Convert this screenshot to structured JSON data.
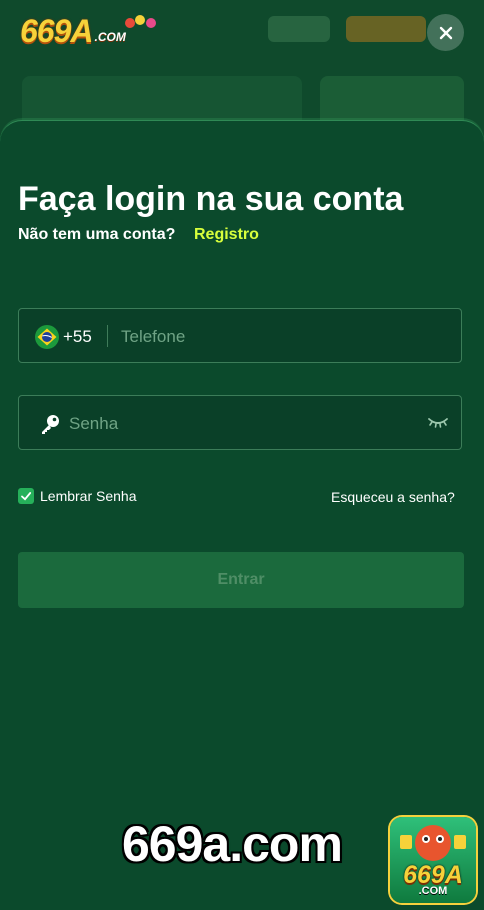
{
  "brand": {
    "logo_text": "669A",
    "logo_suffix": ".COM",
    "watermark": "669a.com",
    "badge_text": "669A",
    "badge_suffix": ".COM"
  },
  "login": {
    "title": "Faça login na sua conta",
    "no_account": "Não tem uma conta?",
    "register": "Registro",
    "phone": {
      "dial_code": "+55",
      "placeholder": "Telefone",
      "value": ""
    },
    "password": {
      "placeholder": "Senha",
      "value": ""
    },
    "remember_label": "Lembrar Senha",
    "remember_checked": true,
    "forgot": "Esqueceu a senha?",
    "submit": "Entrar"
  },
  "icons": {
    "close": "close-icon",
    "flag": "brazil-flag-icon",
    "key": "key-icon",
    "eye": "eye-closed-icon",
    "check": "check-icon"
  },
  "colors": {
    "background": "#0b4a2c",
    "accent_link": "#d8ff3c",
    "logo_gold": "#f6d23a",
    "checkbox": "#26b05a",
    "button_disabled": "#1b6a3d"
  }
}
